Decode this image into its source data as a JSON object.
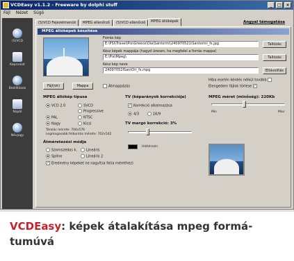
{
  "window": {
    "title": "VCDEasy v1.1.2 - Freeware by dolphi stuff",
    "min_label": "_",
    "max_label": "□",
    "close_label": "×"
  },
  "menu": [
    "Fájl",
    "Nézet",
    "Súgó"
  ],
  "sidebar": {
    "items": [
      {
        "label": "(S)VCD",
        "icon": "disc-icon"
      },
      {
        "label": "Kapcsolat",
        "icon": "clip-icon"
      },
      {
        "label": "Beállítások",
        "icon": "settings-icon"
      },
      {
        "label": "Napló",
        "icon": "log-icon"
      },
      {
        "label": "Névjegy",
        "icon": "info-icon"
      }
    ]
  },
  "tabs": [
    {
      "label": "(S)VCD Fejezetmenük",
      "active": false
    },
    {
      "label": "MPEG ellenőrző",
      "active": false
    },
    {
      "label": "(S)VCD ellenőrző",
      "active": false
    },
    {
      "label": "MPEG állóképek",
      "active": true
    }
  ],
  "top_link": "Angyal támogatása",
  "panel": {
    "header": "MPEG állóképek készítése",
    "source_label": "Forrás kép",
    "source_value": "E:\\PSI\\Travel\\Pix\\Greece\\Oia\\Santorini\\240970521\\Santorini_fs.jpg",
    "browse1": "Tallózás",
    "target_dir_label": "Kész képek mappája (hagyd üresen, ha megfelel a forrás mappa)",
    "target_dir_value": "E:\\Pix\\Mpeg\\",
    "browse2": "Tallózás",
    "filename_label": "Kész kép neve",
    "filename_value": "24097052ISantOri_fs.mpg",
    "delete_button": "Eltávolítás",
    "preview_button": "Fájl(ok)",
    "folder_button": "Mappa",
    "auto_label": "Átmappázás",
    "opt_right1": "Hiba esetén kérdés nélkül tovább",
    "opt_right2": "Elengedem fájlok törlése"
  },
  "mpeg_type": {
    "title": "MPEG állókép típusa",
    "options": [
      "VCD 2.0",
      "SVCD",
      "Progressive"
    ],
    "tv_options": [
      "PAL",
      "NTSC",
      "Nagy",
      "Kicsi"
    ],
    "res_line1": "Tárolás mérete: 704x576",
    "res_line2": "Legmagasabb felbontás mérete: 702x542"
  },
  "aspect": {
    "title": "Átméretezési módja",
    "options": [
      "Szomszédos k.",
      "Lineáris",
      "Spline",
      "Lineáris 2"
    ],
    "checkbox": "Eredmény képeket ne nagyítsa fel(a mérethez)"
  },
  "tv_correction": {
    "title": "TV (képarányok korrekciója)",
    "check_label": "Korrekció alkalmazása",
    "ratio_options": [
      "4/3",
      "16/9"
    ],
    "margin_title": "TV margó korrekció: 3%",
    "bg_label": "Háttérszín",
    "margin_value": 3
  },
  "size": {
    "title": "MPEG méret (minőség): 220Kb",
    "min_label": "Min",
    "max_label": "Max",
    "level": 0.45
  },
  "caption": {
    "accent": "VCDEasy",
    "rest": ": képek átalakítása mpeg formá-tumúvá"
  }
}
